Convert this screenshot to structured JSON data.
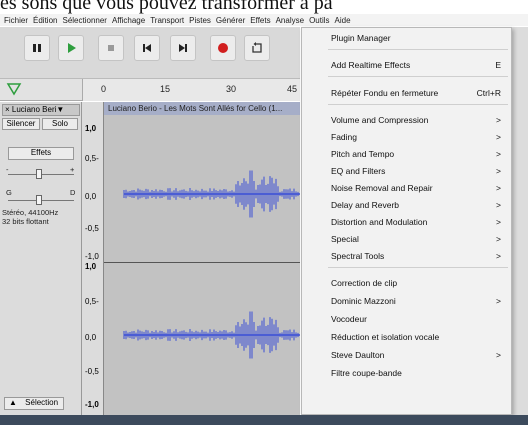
{
  "overlay_text": "es sons que vous pouvez transformer à pa",
  "menubar": [
    "Fichier",
    "Édition",
    "Sélectionner",
    "Affichage",
    "Transport",
    "Pistes",
    "Générer",
    "Effets",
    "Analyse",
    "Outils",
    "Aide"
  ],
  "ruler": {
    "ticks": [
      "0",
      "15",
      "30",
      "45"
    ]
  },
  "track": {
    "name": "Luciano Beri▼",
    "mute_label": "Silencer",
    "solo_label": "Solo",
    "effects_label": "Effets",
    "gain_minus": "-",
    "gain_plus": "+",
    "pan_left": "G",
    "pan_right": "D",
    "info_line1": "Stéréo, 44100Hz",
    "info_line2": "32 bits flottant",
    "select_label": "Sélection",
    "scale_labels": [
      "1,0",
      "0,5-",
      "0,0",
      "-0,5",
      "-1,0"
    ],
    "clip_title": "Luciano Berio - Les Mots Sont Allés for Cello (1..."
  },
  "effects_menu": {
    "items": [
      {
        "label": "Plugin Manager",
        "shortcut": "",
        "submenu": false
      },
      {
        "label": "Add Realtime Effects",
        "shortcut": "E",
        "submenu": false
      },
      {
        "label": "Répéter Fondu en fermeture",
        "shortcut": "Ctrl+R",
        "submenu": false
      },
      {
        "label": "Volume and Compression",
        "shortcut": "",
        "submenu": true
      },
      {
        "label": "Fading",
        "shortcut": "",
        "submenu": true
      },
      {
        "label": "Pitch and Tempo",
        "shortcut": "",
        "submenu": true
      },
      {
        "label": "EQ and Filters",
        "shortcut": "",
        "submenu": true
      },
      {
        "label": "Noise Removal and Repair",
        "shortcut": "",
        "submenu": true
      },
      {
        "label": "Delay and Reverb",
        "shortcut": "",
        "submenu": true
      },
      {
        "label": "Distortion and Modulation",
        "shortcut": "",
        "submenu": true
      },
      {
        "label": "Special",
        "shortcut": "",
        "submenu": true
      },
      {
        "label": "Spectral Tools",
        "shortcut": "",
        "submenu": true
      },
      {
        "label": "Correction de clip",
        "shortcut": "",
        "submenu": false
      },
      {
        "label": "Dominic Mazzoni",
        "shortcut": "",
        "submenu": true
      },
      {
        "label": "Vocodeur",
        "shortcut": "",
        "submenu": false
      },
      {
        "label": "Réduction et isolation vocale",
        "shortcut": "",
        "submenu": false
      },
      {
        "label": "Steve Daulton",
        "shortcut": "",
        "submenu": true
      },
      {
        "label": "Filtre coupe-bande",
        "shortcut": "",
        "submenu": false
      }
    ],
    "arrow_glyph": ">"
  },
  "colors": {
    "play": "#2e9e3e",
    "record": "#d11e1e",
    "waveform": "#3a4fd6"
  }
}
